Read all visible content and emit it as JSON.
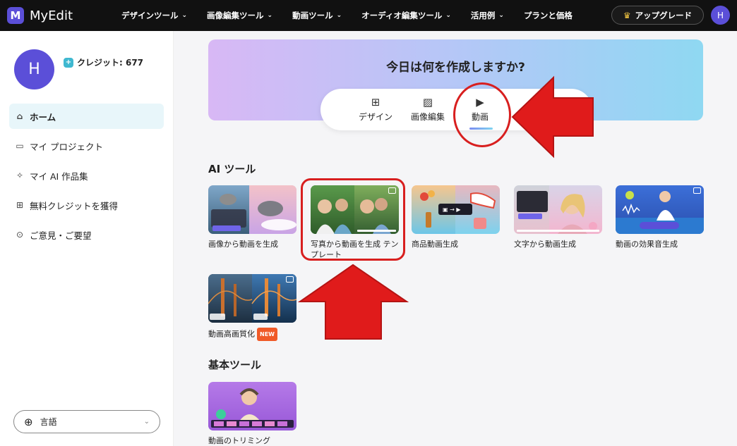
{
  "app": {
    "logo_letter": "M",
    "name": "MyEdit"
  },
  "nav": [
    {
      "label": "デザインツール"
    },
    {
      "label": "画像編集ツール"
    },
    {
      "label": "動画ツール"
    },
    {
      "label": "オーディオ編集ツール"
    },
    {
      "label": "活用例"
    },
    {
      "label": "プランと価格"
    }
  ],
  "upgrade_label": "アップグレード",
  "user": {
    "initial": "H",
    "credit_label": "クレジット: 677"
  },
  "sidebar": {
    "items": [
      {
        "label": "ホーム",
        "icon": "home-icon",
        "active": true
      },
      {
        "label": "マイ プロジェクト",
        "icon": "folder-icon"
      },
      {
        "label": "マイ AI 作品集",
        "icon": "sparkle-icon"
      },
      {
        "label": "無料クレジットを獲得",
        "icon": "gift-icon"
      },
      {
        "label": "ご意見・ご要望",
        "icon": "feedback-icon"
      }
    ],
    "language_label": "言語"
  },
  "hero": {
    "title": "今日は何を作成しますか?",
    "tabs": [
      {
        "label": "デザイン",
        "icon": "design-icon"
      },
      {
        "label": "画像編集",
        "icon": "image-icon"
      },
      {
        "label": "動画",
        "icon": "video-icon",
        "active": true
      }
    ]
  },
  "ai_tools": {
    "title": "AI ツール",
    "cards": [
      {
        "label": "画像から動画を生成"
      },
      {
        "label": "写真から動画を生成 テンプレート"
      },
      {
        "label": "商品動画生成"
      },
      {
        "label": "文字から動画生成"
      },
      {
        "label": "動画の効果音生成"
      },
      {
        "label": "動画高画質化",
        "badge": "NEW"
      }
    ]
  },
  "basic_tools": {
    "title": "基本ツール",
    "cards": [
      {
        "label": "動画のトリミング"
      }
    ]
  },
  "colors": {
    "accent": "#5b4fd8",
    "annotation": "#d81f1f"
  }
}
